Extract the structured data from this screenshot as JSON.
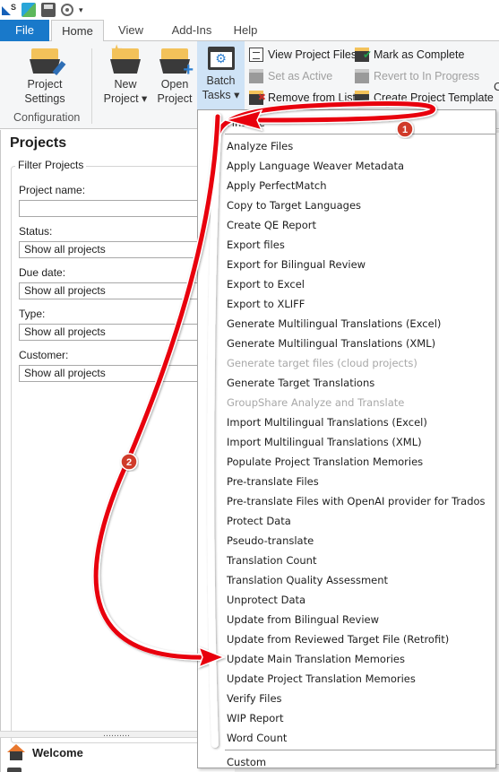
{
  "quick_access": {
    "icons": [
      "app-logo-icon",
      "plugin-icon",
      "save-icon",
      "preview-icon",
      "customize-dropdown-icon"
    ]
  },
  "tabs": [
    {
      "label": "File",
      "active": false
    },
    {
      "label": "Home",
      "active": true
    },
    {
      "label": "View",
      "active": false
    },
    {
      "label": "Add-Ins",
      "active": false
    },
    {
      "label": "Help",
      "active": false
    }
  ],
  "ribbon": {
    "project_settings": {
      "line1": "Project",
      "line2": "Settings"
    },
    "configuration_group": "Configuration",
    "new_project": {
      "line1": "New",
      "line2": "Project ▾"
    },
    "open_project": {
      "line1": "Open",
      "line2": "Project"
    },
    "batch_tasks": {
      "line1": "Batch",
      "line2": "Tasks ▾"
    },
    "small_buttons": [
      {
        "label": "View Project Files",
        "disabled": false,
        "icon": "document-icon"
      },
      {
        "label": "Mark as Complete",
        "disabled": false,
        "icon": "folder-check-icon"
      },
      {
        "label": "Set as Active",
        "disabled": true,
        "icon": "folder-gear-icon"
      },
      {
        "label": "Revert to In Progress",
        "disabled": true,
        "icon": "folder-revert-icon"
      },
      {
        "label": "Remove from List",
        "disabled": false,
        "icon": "folder-remove-icon"
      },
      {
        "label": "Create Project Template",
        "disabled": false,
        "icon": "template-icon"
      }
    ],
    "partial_right_label": "C"
  },
  "projects_pane": {
    "title": "Projects",
    "filter_group": "Filter Projects",
    "fields": [
      {
        "label": "Project name:",
        "value": "",
        "type": "text"
      },
      {
        "label": "Status:",
        "value": "Show all projects",
        "type": "select"
      },
      {
        "label": "Due date:",
        "value": "Show all projects",
        "type": "select"
      },
      {
        "label": "Type:",
        "value": "Show all projects",
        "type": "select"
      },
      {
        "label": "Customer:",
        "value": "Show all projects",
        "type": "select"
      }
    ],
    "splitter_grip": "‥‥‥‥‥",
    "nav_welcome": "Welcome"
  },
  "batch_menu": {
    "items": [
      {
        "label": "Finalize",
        "disabled": false
      },
      {
        "label": "Analyze Files",
        "disabled": false
      },
      {
        "label": "Apply Language Weaver Metadata",
        "disabled": false
      },
      {
        "label": "Apply PerfectMatch",
        "disabled": false
      },
      {
        "label": "Copy to Target Languages",
        "disabled": false
      },
      {
        "label": "Create QE Report",
        "disabled": false
      },
      {
        "label": "Export files",
        "disabled": false
      },
      {
        "label": "Export for Bilingual Review",
        "disabled": false
      },
      {
        "label": "Export to Excel",
        "disabled": false
      },
      {
        "label": "Export to XLIFF",
        "disabled": false
      },
      {
        "label": "Generate Multilingual Translations (Excel)",
        "disabled": false
      },
      {
        "label": "Generate Multilingual Translations (XML)",
        "disabled": false
      },
      {
        "label": "Generate target files (cloud projects)",
        "disabled": true
      },
      {
        "label": "Generate Target Translations",
        "disabled": false
      },
      {
        "label": "GroupShare Analyze and Translate",
        "disabled": true
      },
      {
        "label": "Import Multilingual Translations (Excel)",
        "disabled": false
      },
      {
        "label": "Import Multilingual Translations (XML)",
        "disabled": false
      },
      {
        "label": "Populate Project Translation Memories",
        "disabled": false
      },
      {
        "label": "Pre-translate Files",
        "disabled": false
      },
      {
        "label": "Pre-translate Files with OpenAI provider for Trados",
        "disabled": false
      },
      {
        "label": "Protect Data",
        "disabled": false
      },
      {
        "label": "Pseudo-translate",
        "disabled": false
      },
      {
        "label": "Translation Count",
        "disabled": false
      },
      {
        "label": "Translation Quality Assessment",
        "disabled": false
      },
      {
        "label": "Unprotect Data",
        "disabled": false
      },
      {
        "label": "Update from Bilingual Review",
        "disabled": false
      },
      {
        "label": "Update from Reviewed Target File (Retrofit)",
        "disabled": false
      },
      {
        "label": "Update Main Translation Memories",
        "disabled": false
      },
      {
        "label": "Update Project Translation Memories",
        "disabled": false
      },
      {
        "label": "Verify Files",
        "disabled": false
      },
      {
        "label": "WIP Report",
        "disabled": false
      },
      {
        "label": "Word Count",
        "disabled": false
      }
    ],
    "custom": "Custom"
  },
  "annotations": {
    "badge1": "1",
    "badge2": "2",
    "arrow_color": "#e8000b",
    "badge_color": "#d03a2a"
  },
  "colors": {
    "file_tab": "#1979ca",
    "ribbon_bg": "#f5f6f7",
    "batch_highlight": "#cfe3f6"
  }
}
